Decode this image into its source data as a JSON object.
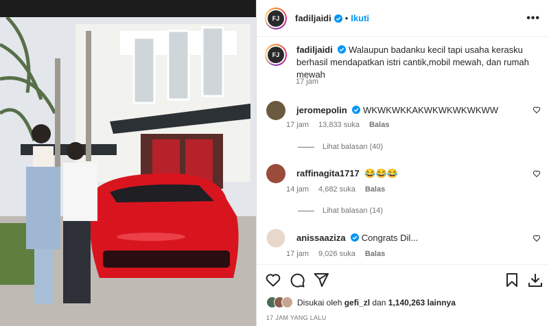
{
  "post": {
    "username": "fadiljaidi",
    "follow_label": "Ikuti",
    "more_label": "•••",
    "avatar_text": "FJ",
    "caption": "Walaupun badanku kecil tapi usaha kerasku berhasil mendapatkan istri cantik,mobil mewah, dan rumah mewah",
    "caption_time": "17 jam"
  },
  "comments": [
    {
      "username": "jeromepolin",
      "text": "WKWKWKKAKWKWKWKWKWW",
      "time": "17 jam",
      "likes": "13,833 suka",
      "reply": "Balas",
      "view_replies": "Lihat balasan (40)",
      "avatar_color": "#6b5a3e"
    },
    {
      "username": "raffinagita1717",
      "text": "😂😂😂",
      "time": "14 jam",
      "likes": "4,682 suka",
      "reply": "Balas",
      "view_replies": "Lihat balasan (14)",
      "avatar_color": "#9a4b3a"
    },
    {
      "username": "anissaaziza",
      "text": "Congrats Dil...",
      "time": "17 jam",
      "likes": "9,026 suka",
      "reply": "Balas",
      "view_replies": "",
      "avatar_color": "#e8d8cc"
    }
  ],
  "likes": {
    "prefix": "Disukai oleh",
    "user": "gefi_zl",
    "middle": "dan",
    "count": "1,140,263",
    "suffix": "lainnya"
  },
  "date": "17 JAM YANG LALU",
  "colors": {
    "accent": "#0095f6",
    "verified": "#0095f6",
    "car": "#d8151f"
  }
}
